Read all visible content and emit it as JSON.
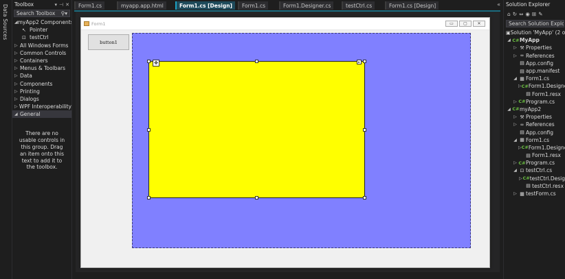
{
  "datasources": {
    "label": "Data Sources"
  },
  "toolbox": {
    "title": "Toolbox",
    "title_buttons": [
      "▾",
      "⊣",
      "✕"
    ],
    "search_placeholder": "Search Toolbox",
    "search_icon": "search-icon",
    "groups": [
      {
        "label": "myApp2 Components",
        "expanded": true,
        "children": [
          {
            "label": "Pointer",
            "icon": "pointer-icon"
          },
          {
            "label": "testCtrl",
            "icon": "user-control-icon"
          }
        ]
      },
      {
        "label": "All Windows Forms",
        "expanded": false
      },
      {
        "label": "Common Controls",
        "expanded": false
      },
      {
        "label": "Containers",
        "expanded": false
      },
      {
        "label": "Menus & Toolbars",
        "expanded": false
      },
      {
        "label": "Data",
        "expanded": false
      },
      {
        "label": "Components",
        "expanded": false
      },
      {
        "label": "Printing",
        "expanded": false
      },
      {
        "label": "Dialogs",
        "expanded": false
      },
      {
        "label": "WPF Interoperability",
        "expanded": false
      },
      {
        "label": "General",
        "expanded": true,
        "selected": true
      }
    ],
    "empty_message": "There are no usable controls in this group. Drag an item onto this text to add it to the toolbox."
  },
  "tabs": [
    {
      "label": "Form1.cs",
      "active": false
    },
    {
      "label": "myapp.app.html",
      "active": false
    },
    {
      "label": "Form1.cs [Design]",
      "active": true
    },
    {
      "label": "Form1.cs",
      "active": false
    },
    {
      "label": "Form1.Designer.cs",
      "active": false
    },
    {
      "label": "testCtrl.cs",
      "active": false
    },
    {
      "label": "Form1.cs [Design]",
      "active": false
    }
  ],
  "tab_overflow": "«",
  "designer": {
    "form_title": "Form1",
    "window_buttons": [
      "▭",
      "▢",
      "✕"
    ],
    "button1_label": "button1",
    "colors": {
      "outer_panel": "#8080ff",
      "inner_panel": "#ffff00",
      "form_bg": "#f0f0f0"
    }
  },
  "solution_explorer": {
    "title": "Solution Explorer",
    "toolbar_icons": [
      "⌂",
      "↻",
      "⇔",
      "◉",
      "⊞",
      "✎"
    ],
    "search_placeholder": "Search Solution Explorer (Ct",
    "tree": [
      {
        "label": "Solution 'MyApp' (2 of",
        "icon": "solution-icon",
        "level": 0,
        "arrow": ""
      },
      {
        "label": "MyApp",
        "icon": "csproj-icon",
        "level": 0,
        "arrow": "◢",
        "bold": true
      },
      {
        "label": "Properties",
        "icon": "wrench-icon",
        "level": 1,
        "arrow": "▷"
      },
      {
        "label": "References",
        "icon": "references-icon",
        "level": 1,
        "arrow": "▷"
      },
      {
        "label": "App.config",
        "icon": "config-icon",
        "level": 1,
        "arrow": ""
      },
      {
        "label": "app.manifest",
        "icon": "manifest-icon",
        "level": 1,
        "arrow": ""
      },
      {
        "label": "Form1.cs",
        "icon": "form-icon",
        "level": 1,
        "arrow": "◢"
      },
      {
        "label": "Form1.Designer",
        "icon": "cs-file-icon",
        "level": 2,
        "arrow": "▷"
      },
      {
        "label": "Form1.resx",
        "icon": "resx-icon",
        "level": 2,
        "arrow": ""
      },
      {
        "label": "Program.cs",
        "icon": "cs-file-icon",
        "level": 1,
        "arrow": "▷"
      },
      {
        "label": "myApp2",
        "icon": "csproj-icon",
        "level": 0,
        "arrow": "◢"
      },
      {
        "label": "Properties",
        "icon": "wrench-icon",
        "level": 1,
        "arrow": "▷"
      },
      {
        "label": "References",
        "icon": "references-icon",
        "level": 1,
        "arrow": "▷"
      },
      {
        "label": "App.config",
        "icon": "config-icon",
        "level": 1,
        "arrow": ""
      },
      {
        "label": "Form1.cs",
        "icon": "form-icon",
        "level": 1,
        "arrow": "◢"
      },
      {
        "label": "Form1.Designer",
        "icon": "cs-file-icon",
        "level": 2,
        "arrow": "▷"
      },
      {
        "label": "Form1.resx",
        "icon": "resx-icon",
        "level": 2,
        "arrow": ""
      },
      {
        "label": "Program.cs",
        "icon": "cs-file-icon",
        "level": 1,
        "arrow": "▷"
      },
      {
        "label": "testCtrl.cs",
        "icon": "user-control-icon",
        "level": 1,
        "arrow": "◢"
      },
      {
        "label": "testCtrl.Desig",
        "icon": "cs-file-icon",
        "level": 2,
        "arrow": "▷"
      },
      {
        "label": "testCtrl.resx",
        "icon": "resx-icon",
        "level": 2,
        "arrow": ""
      },
      {
        "label": "testForm.cs",
        "icon": "form-icon",
        "level": 1,
        "arrow": "▷"
      }
    ]
  },
  "theme": {
    "accent": "#1ba1c2",
    "background": "#1e1e1e",
    "tab_active": "#1e4a5a"
  }
}
